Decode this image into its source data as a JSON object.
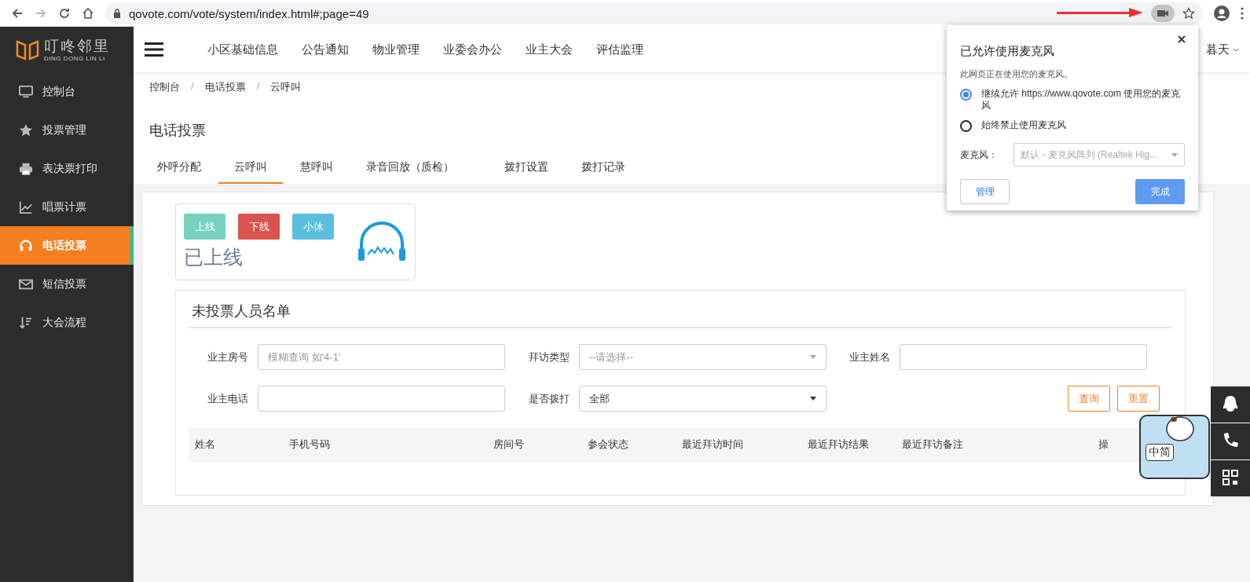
{
  "browser": {
    "url": "qovote.com/vote/system/index.html#;page=49"
  },
  "logo": {
    "name": "叮咚邻里",
    "subtitle": "DING DONG LIN LI"
  },
  "sidebar": {
    "items": [
      {
        "label": "控制台",
        "kind": "monitor",
        "selected": false
      },
      {
        "label": "投票管理",
        "kind": "star",
        "selected": false
      },
      {
        "label": "表决票打印",
        "kind": "printer",
        "selected": false
      },
      {
        "label": "唱票计票",
        "kind": "chart",
        "selected": false
      },
      {
        "label": "电话投票",
        "kind": "headphones",
        "selected": true
      },
      {
        "label": "短信投票",
        "kind": "envelope",
        "selected": false
      },
      {
        "label": "大会流程",
        "kind": "sort",
        "selected": false
      }
    ]
  },
  "top_nav": {
    "items": [
      "小区基础信息",
      "公告通知",
      "物业管理",
      "业委会办公",
      "业主大会",
      "评估监理"
    ],
    "user": "暮天"
  },
  "breadcrumb": [
    "控制台",
    "电话投票",
    "云呼叫"
  ],
  "breadcrumb_separator": "/",
  "page_title": "电话投票",
  "tabs": [
    {
      "label": "外呼分配",
      "selected": false
    },
    {
      "label": "云呼叫",
      "selected": true
    },
    {
      "label": "慧呼叫",
      "selected": false
    },
    {
      "label": "录音回放（质检）",
      "selected": false
    },
    {
      "label": "拨打设置",
      "selected": false
    },
    {
      "label": "拨打记录",
      "selected": false
    }
  ],
  "status_card": {
    "buttons": [
      {
        "label": "上线",
        "color": "#77d1bd"
      },
      {
        "label": "下线",
        "color": "#d9534f"
      },
      {
        "label": "小休",
        "color": "#5bc0de"
      }
    ],
    "status": "已上线"
  },
  "list_panel": {
    "title": "未投票人员名单",
    "filters": [
      {
        "label": "业主房号",
        "kind": "text",
        "placeholder": "模糊查询 如'4-1'"
      },
      {
        "label": "拜访类型",
        "kind": "select",
        "placeholder": "--请选择--"
      },
      {
        "label": "业主姓名",
        "kind": "text"
      },
      {
        "label": "业主电话",
        "kind": "text"
      },
      {
        "label": "是否拨打",
        "kind": "select",
        "value": "全部"
      }
    ],
    "buttons": [
      "查询",
      "重置"
    ],
    "table": {
      "columns": [
        "姓名",
        "手机号码",
        "房间号",
        "参会状态",
        "最近拜访时间",
        "最近拜访结果",
        "最近拜访备注",
        "操"
      ]
    }
  },
  "popup": {
    "title": "已允许使用麦克风",
    "subtitle": "此网页正在使用您的麦克风。",
    "options": [
      {
        "label": "继续允许 https://www.qovote.com 使用您的麦克风",
        "selected": true
      },
      {
        "label": "始终禁止使用麦克风",
        "selected": false
      }
    ],
    "mic_label": "麦克风：",
    "mic_value": "默认 - 麦克风阵列 (Realtek Hig...",
    "buttons": [
      {
        "label": "管理",
        "kind": "secondary"
      },
      {
        "label": "完成",
        "kind": "primary"
      }
    ]
  },
  "ime_badge": {
    "text": "中简"
  }
}
